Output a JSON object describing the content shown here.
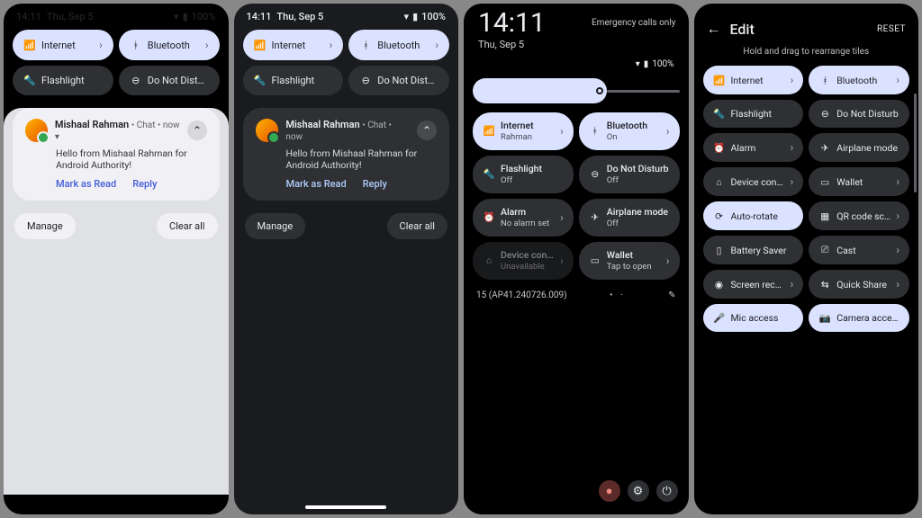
{
  "shared": {
    "time": "14:11",
    "date": "Thu, Sep 5",
    "battery": "100%",
    "tiles": {
      "internet": "Internet",
      "bluetooth": "Bluetooth",
      "flashlight": "Flashlight",
      "dnd": "Do Not Disturb"
    },
    "notif": {
      "sender": "Mishaal Rahman",
      "meta": "Chat • now",
      "body": "Hello from Mishaal Rahman for Android Authority!",
      "action_read": "Mark as Read",
      "action_reply": "Reply"
    },
    "manage": "Manage",
    "clear_all": "Clear all"
  },
  "p3": {
    "emergency": "Emergency calls only",
    "internet_sub": "Rahman",
    "bluetooth_sub": "On",
    "flashlight_sub": "Off",
    "dnd_sub": "Off",
    "alarm": "Alarm",
    "alarm_sub": "No alarm set",
    "airplane": "Airplane mode",
    "airplane_sub": "Off",
    "device": "Device contr…",
    "device_sub": "Unavailable",
    "wallet": "Wallet",
    "wallet_sub": "Tap to open",
    "build": "15 (AP41.240726.009)"
  },
  "p4": {
    "title": "Edit",
    "reset": "RESET",
    "hint": "Hold and drag to rearrange tiles",
    "alarm": "Alarm",
    "airplane": "Airplane mode",
    "device": "Device contr…",
    "wallet": "Wallet",
    "autorotate": "Auto-rotate",
    "qr": "QR code sca…",
    "battery_saver": "Battery Saver",
    "cast": "Cast",
    "screen_record": "Screen record",
    "quick_share": "Quick Share",
    "mic": "Mic access",
    "camera": "Camera access"
  }
}
